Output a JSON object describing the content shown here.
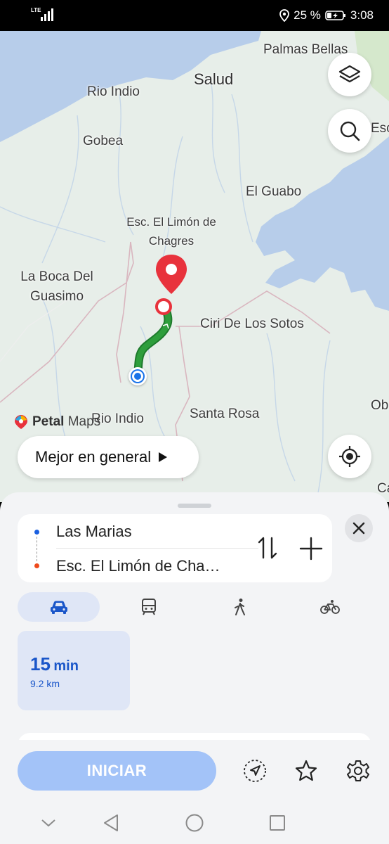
{
  "status_bar": {
    "network": "LTE",
    "battery_percent": "25 %",
    "time": "3:08",
    "icons": [
      "signal-icon",
      "location-icon",
      "battery-saver-icon"
    ]
  },
  "map": {
    "places": {
      "palmas_bellas": "Palmas Bellas",
      "salud": "Salud",
      "rio_indio_north": "Rio Indio",
      "gobea": "Gobea",
      "el_guabo": "El Guabo",
      "destination_label": "Esc. El Limón de Chagres",
      "la_boca": "La Boca Del Guasimo",
      "ciri": "Ciri De Los Sotos",
      "santa_rosa": "Santa Rosa",
      "rio_indio_south": "Rio Indio",
      "edge_esc": "Esc",
      "edge_ob": "Ob",
      "edge_ca": "Ca"
    },
    "brand": {
      "name_bold": "Petal",
      "name_rest": "Maps"
    },
    "route_colors": {
      "route": "#2e9e3c",
      "origin": "#1a73e8",
      "destination": "#e8323c"
    },
    "buttons": [
      "layers-icon",
      "search-icon",
      "my-location-icon"
    ]
  },
  "route_preference": {
    "label": "Mejor en general"
  },
  "route_panel": {
    "from": "Las Marias",
    "to": "Esc. El Limón de Cha…",
    "modes": [
      "car-icon",
      "transit-icon",
      "walk-icon",
      "bike-icon"
    ],
    "selected_mode": "car",
    "option": {
      "time_value": "15",
      "time_unit": "min",
      "distance": "9.2 km"
    }
  },
  "actions": {
    "start_label": "INICIAR",
    "icons": [
      "navigate-icon",
      "favorite-star-icon",
      "settings-gear-icon"
    ]
  },
  "colors": {
    "accent": "#1a56c9",
    "start_button": "#a3c3f8",
    "sheet_bg": "#f3f4f6",
    "map_water": "#b7cdea",
    "map_land": "#e7eee9"
  }
}
